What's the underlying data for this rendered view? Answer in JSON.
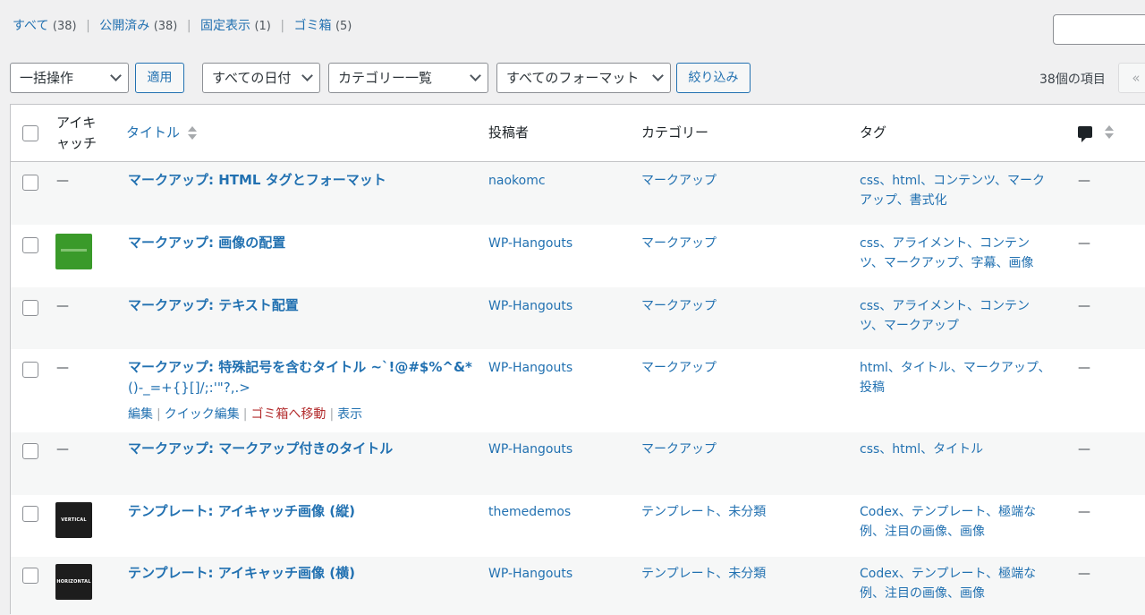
{
  "views": [
    {
      "label": "すべて",
      "count": "(38)"
    },
    {
      "label": "公開済み",
      "count": "(38)"
    },
    {
      "label": "固定表示",
      "count": "(1)"
    },
    {
      "label": "ゴミ箱",
      "count": "(5)"
    }
  ],
  "filters": {
    "bulk_action": "一括操作",
    "apply": "適用",
    "dates": "すべての日付",
    "categories": "カテゴリー一覧",
    "formats": "すべてのフォーマット",
    "filter_button": "絞り込み",
    "items_count": "38個の項目",
    "pager_prev": "«"
  },
  "columns": {
    "thumbnail": "アイキャッチ",
    "title": "タイトル",
    "author": "投稿者",
    "categories": "カテゴリー",
    "tags": "タグ"
  },
  "posts": [
    {
      "thumb": "—",
      "title": "マークアップ: HTML タグとフォーマット",
      "author": "naokomc",
      "categories": "マークアップ",
      "tags_l1": "css、html、コンテンツ、マーク",
      "tags_l2": "アップ、書式化",
      "comments": "—"
    },
    {
      "thumb": "",
      "title": "マークアップ: 画像の配置",
      "author": "WP-Hangouts",
      "categories": "マークアップ",
      "tags_l1": "css、アライメント、コンテン",
      "tags_l2": "ツ、マークアップ、字幕、画像",
      "comments": "—"
    },
    {
      "thumb": "—",
      "title": "マークアップ: テキスト配置",
      "author": "WP-Hangouts",
      "categories": "マークアップ",
      "tags_l1": "css、アライメント、コンテン",
      "tags_l2": "ツ、マークアップ",
      "comments": "—"
    },
    {
      "thumb": "—",
      "title_l1": "マークアップ: 特殊記号を含むタイトル ~`!@#$%^&*",
      "title_l2": "()-_=+{}[]/;:'\"?,.>",
      "author": "WP-Hangouts",
      "categories": "マークアップ",
      "tags_l1": "html、タイトル、マークアップ、",
      "tags_l2": "投稿",
      "comments": "—",
      "actions": {
        "edit": "編集",
        "quick_edit": "クイック編集",
        "trash": "ゴミ箱へ移動",
        "view": "表示"
      }
    },
    {
      "thumb": "—",
      "title": "マークアップ: マークアップ付きのタイトル",
      "author": "WP-Hangouts",
      "categories": "マークアップ",
      "tags_l1": "css、html、タイトル",
      "tags_l2": "",
      "comments": "—"
    },
    {
      "thumb_text": "VERTICAL",
      "title": "テンプレート: アイキャッチ画像 (縦)",
      "author": "themedemos",
      "categories": "テンプレート、未分類",
      "tags_l1": "Codex、テンプレート、極端な",
      "tags_l2": "例、注目の画像、画像",
      "comments": "—"
    },
    {
      "thumb_text": "HORIZONTAL",
      "title": "テンプレート: アイキャッチ画像 (横)",
      "author": "WP-Hangouts",
      "categories": "テンプレート、未分類",
      "tags_l1": "Codex、テンプレート、極端な",
      "tags_l2": "例、注目の画像、画像",
      "comments": "—"
    }
  ]
}
